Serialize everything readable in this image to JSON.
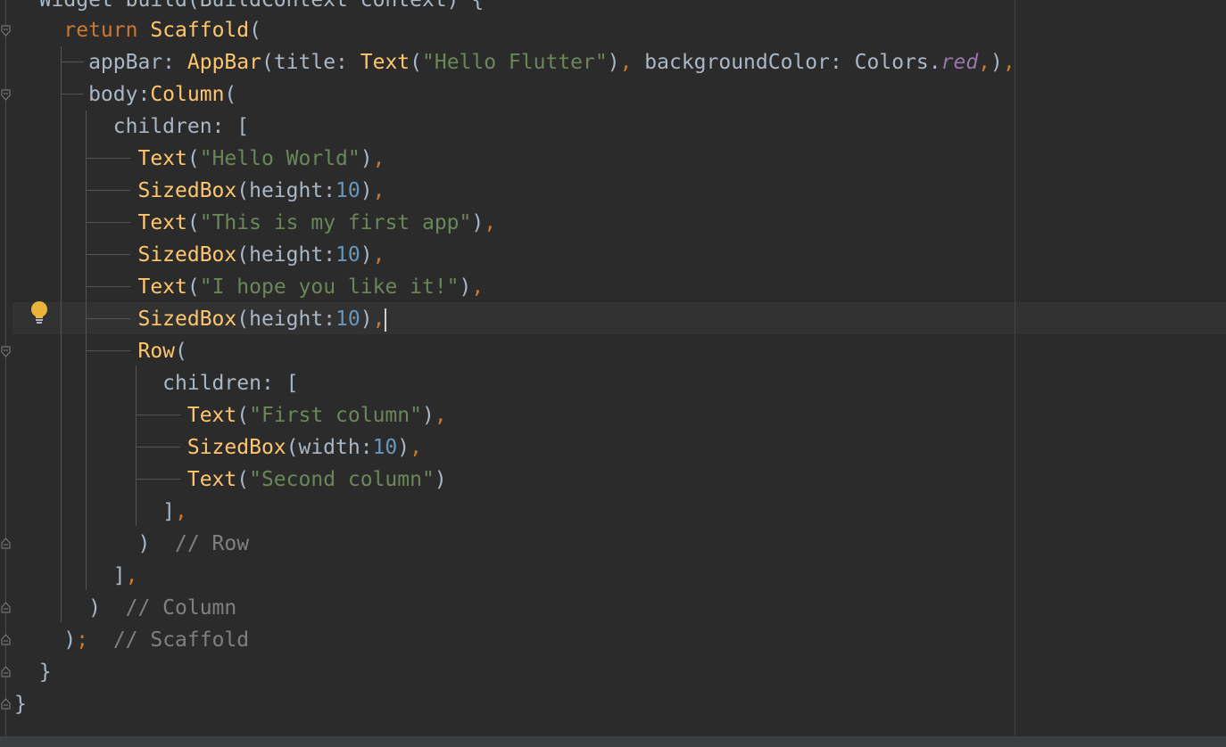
{
  "editor": {
    "lines": [
      "  Widget build(BuildContext context) {",
      "    return Scaffold(",
      "      appBar: AppBar(title: Text(\"Hello Flutter\"), backgroundColor: Colors.red,),",
      "      body:Column(",
      "        children: [",
      "          Text(\"Hello World\"),",
      "          SizedBox(height:10),",
      "          Text(\"This is my first app\"),",
      "          SizedBox(height:10),",
      "          Text(\"I hope you like it!\"),",
      "          SizedBox(height:10),",
      "          Row(",
      "            children: [",
      "              Text(\"First column\"),",
      "              SizedBox(width:10),",
      "              Text(\"Second column\")",
      "            ],",
      "          )  // Row",
      "        ],",
      "      )  // Column",
      "    );  // Scaffold",
      "  }",
      "}"
    ]
  },
  "colors": {
    "background": "#2b2b2b",
    "keyword": "#cc7832",
    "function": "#ffc66d",
    "string": "#6a8759",
    "number": "#6897bb",
    "comment": "#808080",
    "field": "#9876aa",
    "plain": "#a9b7c6",
    "current_line": "#323232",
    "bulb": "#e8b53a"
  },
  "icons": {
    "intention": "lightbulb-icon",
    "fold": "fold-marker-icon"
  }
}
